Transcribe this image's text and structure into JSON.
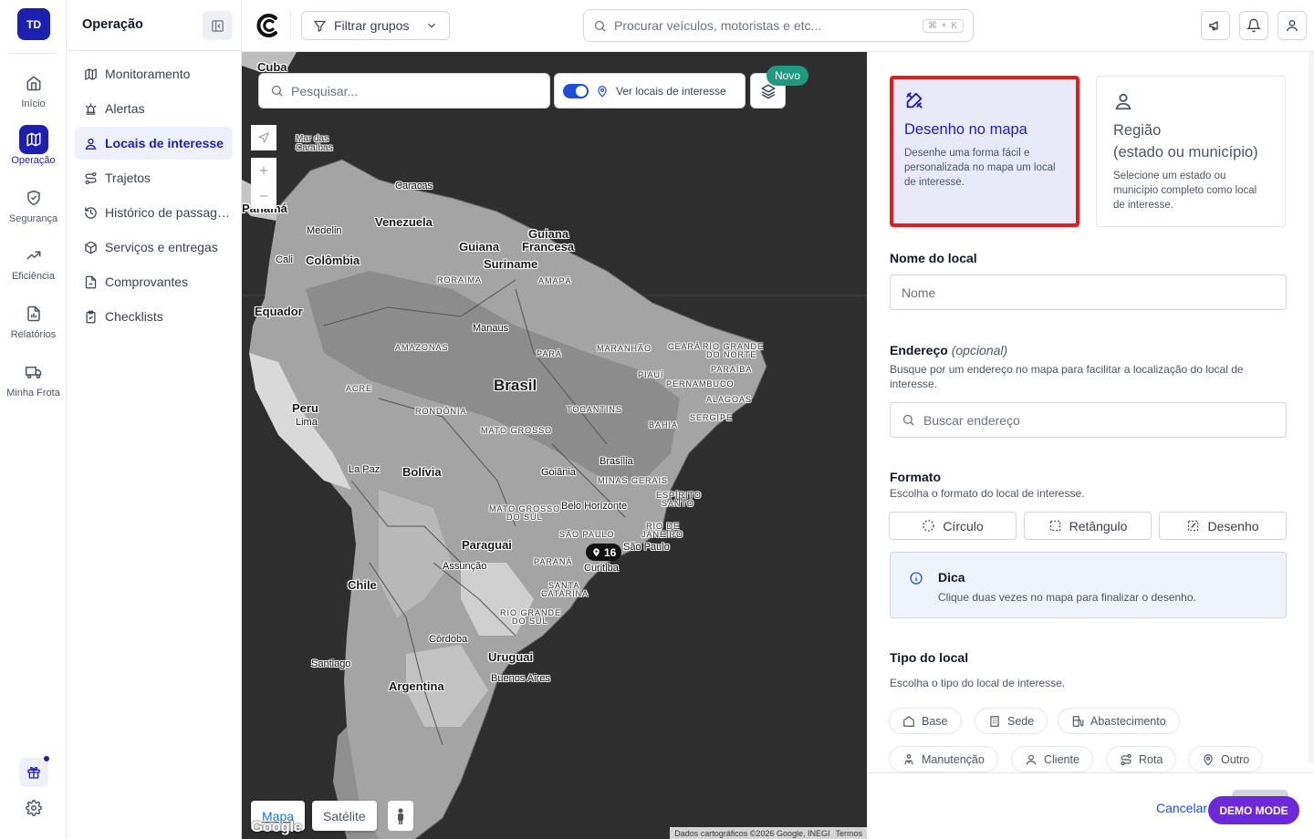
{
  "rail": {
    "badge": "TD",
    "items": [
      {
        "label": "Início",
        "icon": "home-icon"
      },
      {
        "label": "Operação",
        "icon": "map-icon",
        "active": true
      },
      {
        "label": "Segurança",
        "icon": "shield-icon"
      },
      {
        "label": "Eficiência",
        "icon": "trending-up-icon"
      },
      {
        "label": "Relatórios",
        "icon": "report-icon"
      },
      {
        "label": "Minha Frota",
        "icon": "truck-icon"
      }
    ]
  },
  "sidebar": {
    "title": "Operação",
    "items": [
      {
        "label": "Monitoramento",
        "icon": "map-icon"
      },
      {
        "label": "Alertas",
        "icon": "siren-icon"
      },
      {
        "label": "Locais de interesse",
        "icon": "user-pin-icon",
        "active": true
      },
      {
        "label": "Trajetos",
        "icon": "route-icon"
      },
      {
        "label": "Histórico de passagem",
        "icon": "history-icon"
      },
      {
        "label": "Serviços e entregas",
        "icon": "package-icon"
      },
      {
        "label": "Comprovantes",
        "icon": "file-icon"
      },
      {
        "label": "Checklists",
        "icon": "clipboard-icon"
      }
    ]
  },
  "topbar": {
    "filter_label": "Filtrar grupos",
    "search_placeholder": "Procurar veículos, motoristas e etc...",
    "search_shortcut": "⌘ + K"
  },
  "map": {
    "search_placeholder": "Pesquisar...",
    "toggle_label": "Ver locais de interesse",
    "toggle_on": true,
    "new_badge": "Novo",
    "cluster_count": "16",
    "map_type_map": "Mapa",
    "map_type_satellite": "Satélite",
    "google": "Google",
    "attribution": "Dados cartográficos ©2026 Google, INEGI",
    "terms": "Termos",
    "labels": {
      "cuba": "Cuba",
      "mar1": "Mar das",
      "mar2": "Caraíbas",
      "caracas": "Caracas",
      "venezuela": "Venezuela",
      "medelin": "Medelin",
      "guiana": "Guiana",
      "guiana_fr1": "Guiana",
      "guiana_fr2": "Francesa",
      "suriname": "Suriname",
      "cali": "Cali",
      "colombia": "Colômbia",
      "panama": "Panamá",
      "roraima": "RORAIMA",
      "amapa": "AMAPÁ",
      "equador": "Equador",
      "manaus": "Manaus",
      "amazonas": "AMAZONAS",
      "para": "PARÁ",
      "maranhao": "MARANHÃO",
      "ceara": "CEARÁ",
      "rn1": "RIO GRANDE",
      "rn2": "DO NORTE",
      "paraiba": "PARAÍBA",
      "piaui": "PIAUÍ",
      "pernambuco": "PERNAMBUCO",
      "brasil": "Brasil",
      "acre": "ACRE",
      "alagoas": "ALAGOAS",
      "peru": "Peru",
      "rondonia": "RONDÔNIA",
      "tocantins": "TOCANTINS",
      "sergipe": "SERGIPE",
      "lima": "Lima",
      "bahia": "BAHIA",
      "mato_grosso": "MATO GROSSO",
      "brasilia": "Brasília",
      "la_paz": "La Paz",
      "bolivia": "Bolívia",
      "goiania": "Goiânia",
      "minas": "MINAS GERAIS",
      "es1": "ESPÍRITO",
      "es2": "SANTO",
      "ms1": "MATO GROSSO",
      "ms2": "DO SUL",
      "bh": "Belo Horizonte",
      "rj1": "RIO DE",
      "rj2": "JANEIRO",
      "sp": "SÃO PAULO",
      "paraguai": "Paraguai",
      "sao_paulo": "São Paulo",
      "parana": "PARANÁ",
      "curitiba": "Curitiba",
      "assuncao": "Assunção",
      "sc1": "SANTA",
      "sc2": "CATARINA",
      "chile": "Chile",
      "rs1": "RIO GRANDE",
      "rs2": "DO SUL",
      "cordoba": "Córdoba",
      "uruguai": "Uruguai",
      "santiago": "Santiago",
      "argentina": "Argentina",
      "buenos_aires": "Buenos Aires"
    }
  },
  "panel": {
    "card_draw": {
      "title": "Desenho no mapa",
      "desc": "Desenhe uma forma fácil e personalizada no mapa um local de interesse."
    },
    "card_region": {
      "title1": "Região",
      "title2": "(estado ou município)",
      "desc": "Selecione um estado ou município completo como local de interesse."
    },
    "name_label": "Nome do local",
    "name_placeholder": "Nome",
    "address_label": "Endereço",
    "address_optional": "(opcional)",
    "address_help": "Busque por um endereço no mapa para facilitar a localização do local de interesse.",
    "address_placeholder": "Buscar endereço",
    "format_label": "Formato",
    "format_help": "Escolha o formato do local de interesse.",
    "formats": [
      "Círculo",
      "Retângulo",
      "Desenho"
    ],
    "tip_title": "Dica",
    "tip_text": "Clique duas vezes no mapa para finalizar o desenho.",
    "type_label": "Tipo do local",
    "type_help": "Escolha o tipo do local de interesse.",
    "types": [
      "Base",
      "Sede",
      "Abastecimento",
      "Manutenção",
      "Cliente",
      "Rota",
      "Outro"
    ],
    "cancel": "Cancelar",
    "demo_mode": "DEMO MODE"
  },
  "colors": {
    "brand": "#1d1fb0",
    "highlight": "#e11d1d",
    "accent_teal": "#1f9a7e",
    "demo": "#6d28d9"
  }
}
